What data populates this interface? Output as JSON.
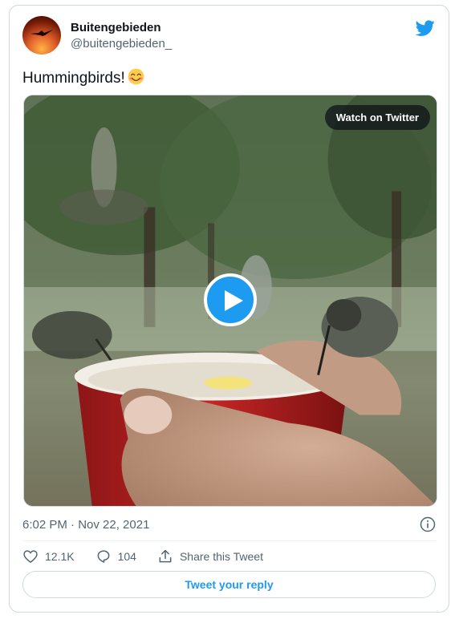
{
  "user": {
    "name": "Buitengebieden",
    "handle": "@buitengebieden_"
  },
  "tweet": {
    "text": "Hummingbirds!",
    "emoji": "smiling-face-with-smiling-eyes",
    "timestamp": "6:02 PM · Nov 22, 2021"
  },
  "media": {
    "watch_label": "Watch on Twitter"
  },
  "actions": {
    "likes": "12.1K",
    "replies": "104",
    "share_label": "Share this Tweet",
    "reply_label": "Tweet your reply"
  },
  "colors": {
    "accent": "#1d9bf0",
    "secondary_text": "#536471",
    "border": "#cfd9de"
  }
}
